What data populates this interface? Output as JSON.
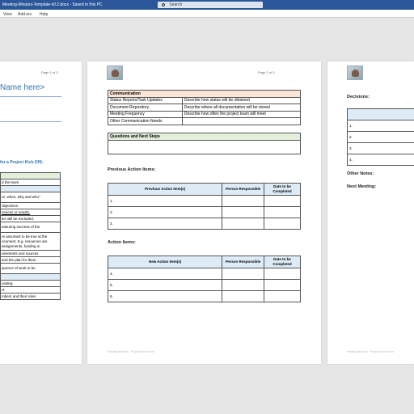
{
  "window": {
    "title": "Meeting-Minutes-Template-v0.2.docx  -  Saved to this PC",
    "search_placeholder": "Search"
  },
  "menu": [
    "View",
    "Add-ins",
    "Help"
  ],
  "page1": {
    "page_number": "Page 1 of 3",
    "name_title": "Name here>",
    "subheading": "for a Project Kick-Off):",
    "rows": [
      "d the team",
      "",
      "re, when, why and who\"",
      "objectives.",
      "ervices or results.",
      "les will be excluded.",
      "easuring success of the",
      "re assumed to be true at the\nocument. E.g. resources are\nassignments, funding is",
      "uirements and sources",
      "and the plan for them.",
      "quence of work to be",
      "",
      "unding",
      "ct",
      "mbers and their roles"
    ]
  },
  "page2": {
    "page_number": "Page 2 of 3",
    "communication": {
      "header": "Communication",
      "rows": [
        [
          "Status Reports/Task Updates",
          "Describe how status will be obtained"
        ],
        [
          "Document Repository",
          "Describe where all documentation will be stored"
        ],
        [
          "Meeting Frequency",
          "Describe how often the project team will meet"
        ],
        [
          "Other Communication Needs",
          ""
        ]
      ]
    },
    "questions_header": "Questions and Next Steps",
    "previous_label": "Previous Action Items:",
    "previous_table": {
      "headers": [
        "Previous Action Item(s)",
        "Person Responsible",
        "Date to be Completed"
      ],
      "rows": [
        "1.",
        "2.",
        "3."
      ]
    },
    "action_label": "Action Items:",
    "action_table": {
      "headers": [
        "New Action Item(s)",
        "Person Responsible",
        "Date to be Completed"
      ],
      "rows": [
        "4.",
        "5.",
        "6."
      ]
    },
    "footer": "Meeting Minutes - Project Name here"
  },
  "page3": {
    "decisions_label": "Decisions:",
    "decision_rows": [
      "1.",
      "2.",
      "3.",
      "4."
    ],
    "other_notes_label": "Other Notes:",
    "next_meeting_label": "Next Meeting:",
    "footer": "Meeting Minutes - Project Name here"
  },
  "page1_footer": "",
  "colors": {
    "titlebar": "#2b579a",
    "heading_blue": "#2e74b5",
    "comm_header": "#fce4d6",
    "green_header": "#e2efda",
    "blue_header": "#ddebf7"
  }
}
